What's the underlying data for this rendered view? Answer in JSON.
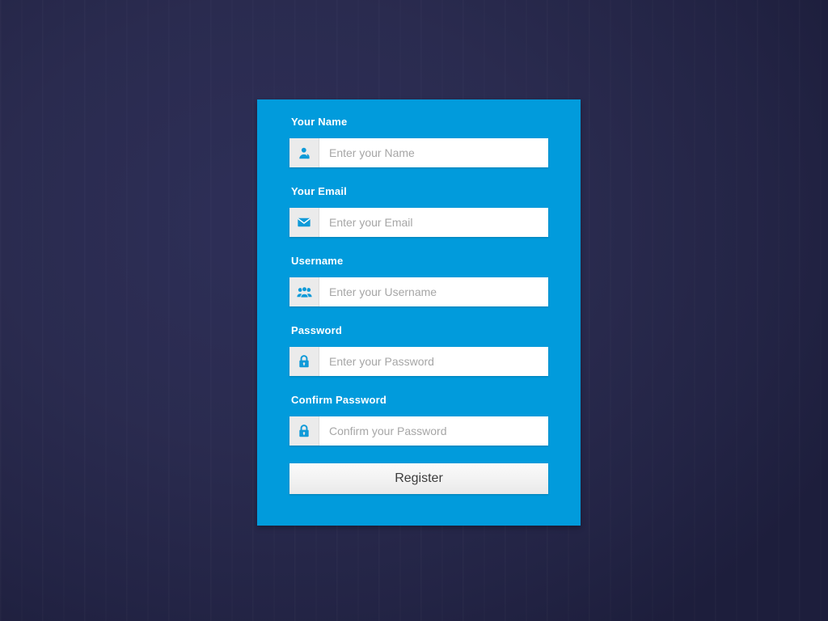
{
  "theme": {
    "card_background": "#019bdc",
    "page_background": "#292a4f",
    "icon_color": "#0f9ad8",
    "icon_tile_background": "#ebebeb",
    "label_color": "#ffffff",
    "placeholder_color": "#a6a6a6",
    "button_text_color": "#3c3c3c"
  },
  "form": {
    "fields": [
      {
        "label": "Your Name",
        "placeholder": "Enter your Name",
        "value": "",
        "icon": "user-icon",
        "name": "name"
      },
      {
        "label": "Your Email",
        "placeholder": "Enter your Email",
        "value": "",
        "icon": "envelope-icon",
        "name": "email"
      },
      {
        "label": "Username",
        "placeholder": "Enter your Username",
        "value": "",
        "icon": "users-group-icon",
        "name": "username"
      },
      {
        "label": "Password",
        "placeholder": "Enter your Password",
        "value": "",
        "icon": "lock-icon",
        "name": "password"
      },
      {
        "label": "Confirm Password",
        "placeholder": "Confirm your Password",
        "value": "",
        "icon": "lock-icon",
        "name": "confirm-password"
      }
    ],
    "submit_label": "Register"
  }
}
